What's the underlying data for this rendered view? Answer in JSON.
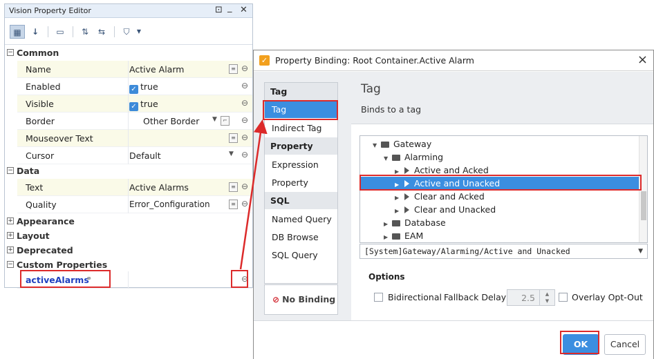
{
  "property_editor": {
    "title": "Vision Property Editor",
    "window_controls": [
      "⊡",
      "_",
      "✕"
    ],
    "sections": {
      "common": "Common",
      "data": "Data",
      "appearance": "Appearance",
      "layout": "Layout",
      "deprecated": "Deprecated",
      "custom": "Custom Properties"
    },
    "rows": {
      "name": {
        "label": "Name",
        "value": "Active Alarm"
      },
      "enabled": {
        "label": "Enabled",
        "value": "true"
      },
      "visible": {
        "label": "Visible",
        "value": "true"
      },
      "border": {
        "label": "Border",
        "value": "Other Border"
      },
      "mouseover": {
        "label": "Mouseover Text",
        "value": ""
      },
      "cursor": {
        "label": "Cursor",
        "value": "Default"
      },
      "text": {
        "label": "Text",
        "value": "Active Alarms"
      },
      "quality": {
        "label": "Quality",
        "value": "Error_Configuration"
      },
      "custom_prop": {
        "label": "activeAlarms",
        "value": ""
      }
    }
  },
  "dialog": {
    "title": "Property Binding: Root Container.Active Alarm",
    "close": "×",
    "nav": {
      "tag_header": "Tag",
      "tag": "Tag",
      "indirect_tag": "Indirect Tag",
      "property_header": "Property",
      "expression": "Expression",
      "property": "Property",
      "sql_header": "SQL",
      "named_query": "Named Query",
      "db_browse": "DB Browse",
      "sql_query": "SQL Query"
    },
    "no_binding": "No Binding",
    "binding_title": "Tag",
    "binding_desc": "Binds to a tag",
    "tree": {
      "gateway": "Gateway",
      "alarming": "Alarming",
      "active_acked": "Active and Acked",
      "active_unacked": "Active and Unacked",
      "clear_acked": "Clear and Acked",
      "clear_unacked": "Clear and Unacked",
      "database": "Database",
      "eam": "EAM"
    },
    "tag_path": "[System]Gateway/Alarming/Active and Unacked",
    "options": {
      "header": "Options",
      "bidirectional": "Bidirectional",
      "fallback_label": "Fallback Delay",
      "fallback_value": "2.5",
      "overlay_opt_out": "Overlay Opt-Out"
    },
    "ok": "OK",
    "cancel": "Cancel"
  },
  "colors": {
    "accent": "#3b8ee0",
    "highlight": "#dc2a2a",
    "custom_prop_text": "#1f3fbf"
  }
}
